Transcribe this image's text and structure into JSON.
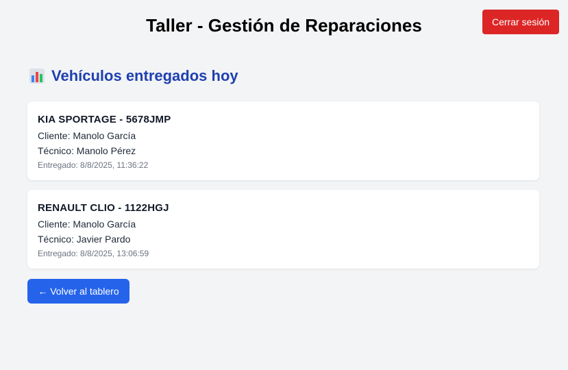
{
  "header": {
    "title": "Taller - Gestión de Reparaciones",
    "logout_label": "Cerrar sesión"
  },
  "section": {
    "icon": "bar-chart-icon",
    "heading": "Vehículos entregados hoy"
  },
  "vehicles": [
    {
      "title": "KIA SPORTAGE - 5678JMP",
      "client": "Cliente: Manolo García",
      "technician": "Técnico: Manolo Pérez",
      "delivered": "Entregado: 8/8/2025, 11:36:22"
    },
    {
      "title": "RENAULT CLIO - 1122HGJ",
      "client": "Cliente: Manolo García",
      "technician": "Técnico: Javier Pardo",
      "delivered": "Entregado: 8/8/2025, 13:06:59"
    }
  ],
  "footer": {
    "back_label": "← Volver al tablero"
  },
  "colors": {
    "background": "#f3f4f6",
    "logout": "#dc2626",
    "primary": "#2563eb",
    "heading": "#1e40af"
  }
}
